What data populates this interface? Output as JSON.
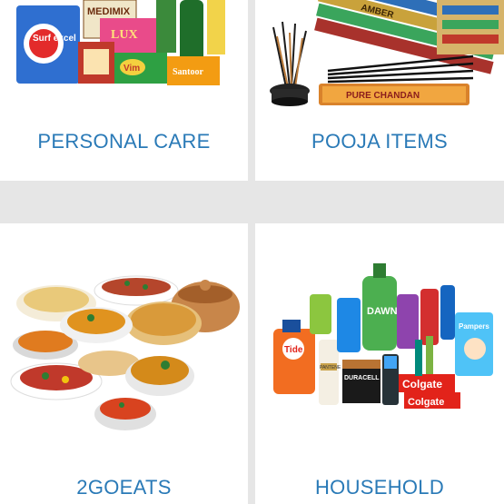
{
  "colors": {
    "background": "#e6e6e6",
    "card": "#ffffff",
    "label": "#2a7ab7"
  },
  "categories": [
    {
      "label": "PERSONAL CARE",
      "image_icon": "personal-care-products-image",
      "product_texts": [
        "Surf excel",
        "MEDIMIX",
        "LUX",
        "Santoor",
        "Vim"
      ]
    },
    {
      "label": "POOJA ITEMS",
      "image_icon": "incense-sticks-image",
      "product_texts": [
        "AMBER",
        "PURE CHANDAN"
      ]
    },
    {
      "label": "2GOEATS",
      "image_icon": "indian-food-dishes-image"
    },
    {
      "label": "HOUSEHOLD",
      "image_icon": "household-products-image",
      "product_texts": [
        "Tide",
        "DAWN",
        "PANTENE",
        "DURACELL",
        "Colgate",
        "Colgate",
        "Pampers"
      ]
    }
  ]
}
